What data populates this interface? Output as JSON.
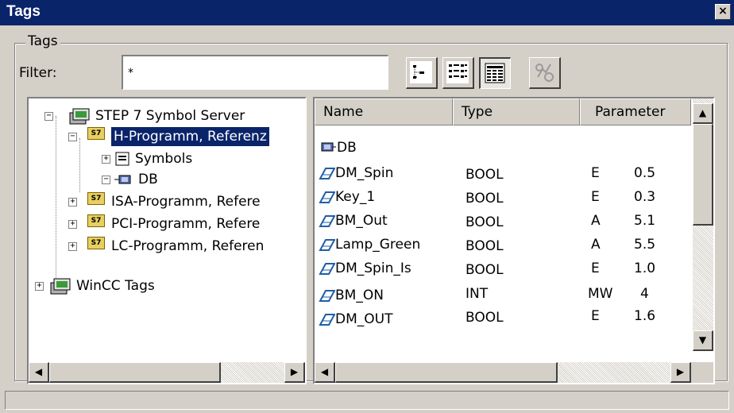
{
  "window": {
    "title": "Tags",
    "close_glyph": "×"
  },
  "group": {
    "label": "Tags"
  },
  "filter": {
    "label": "Filter:",
    "value": "*"
  },
  "toolbar": {
    "buttons": [
      {
        "name": "tree-view-icon",
        "pressed": false
      },
      {
        "name": "details-view-icon",
        "pressed": false
      },
      {
        "name": "list-view-icon",
        "pressed": true
      },
      {
        "name": "connect-icon",
        "pressed": false,
        "disabled": true
      }
    ]
  },
  "tree": {
    "items": [
      {
        "label": "STEP 7 Symbol Server",
        "icon": "server-icon",
        "expander": "−"
      },
      {
        "label": "H-Programm, Referenz",
        "icon": "s7-program-icon",
        "badge": "S7",
        "expander": "−",
        "selected": true
      },
      {
        "label": "Symbols",
        "icon": "symbols-icon",
        "expander": "+"
      },
      {
        "label": "DB",
        "icon": "db-icon",
        "expander": "−"
      },
      {
        "label": "ISA-Programm, Refere",
        "icon": "s7-program-icon",
        "badge": "S7",
        "expander": "+"
      },
      {
        "label": "PCI-Programm, Refere",
        "icon": "s7-program-icon",
        "badge": "S7",
        "expander": "+"
      },
      {
        "label": "LC-Programm, Referen",
        "icon": "s7-program-icon",
        "badge": "S7",
        "expander": "+"
      },
      {
        "label": "WinCC Tags",
        "icon": "server-icon",
        "expander": "+"
      }
    ]
  },
  "list": {
    "columns": [
      "Name",
      "Type",
      "Parameter"
    ],
    "rows": [
      {
        "name": "DB",
        "icon": "db-icon",
        "type": "",
        "area": "",
        "address": ""
      },
      {
        "name": "DM_Spin",
        "icon": "tag-icon",
        "type": "BOOL",
        "area": "E",
        "address": "0.5"
      },
      {
        "name": "Key_1",
        "icon": "tag-icon",
        "type": "BOOL",
        "area": "E",
        "address": "0.3"
      },
      {
        "name": "BM_Out",
        "icon": "tag-icon",
        "type": "BOOL",
        "area": "A",
        "address": "5.1"
      },
      {
        "name": "Lamp_Green",
        "icon": "tag-icon",
        "type": "BOOL",
        "area": "A",
        "address": "5.5"
      },
      {
        "name": "DM_Spin_Is",
        "icon": "tag-icon",
        "type": "BOOL",
        "area": "E",
        "address": "1.0"
      },
      {
        "name": "BM_ON",
        "icon": "tag-icon",
        "type": "INT",
        "area": "MW",
        "address": "4"
      },
      {
        "name": "DM_OUT",
        "icon": "tag-icon",
        "type": "BOOL",
        "area": "E",
        "address": "1.6"
      }
    ]
  },
  "scroll": {
    "up": "▲",
    "down": "▼",
    "left": "◀",
    "right": "▶"
  },
  "colors": {
    "titlebar": "#0a246a",
    "face": "#d4d0c8",
    "selection": "#0a246a",
    "tag_icon": "#1f5fa8"
  }
}
